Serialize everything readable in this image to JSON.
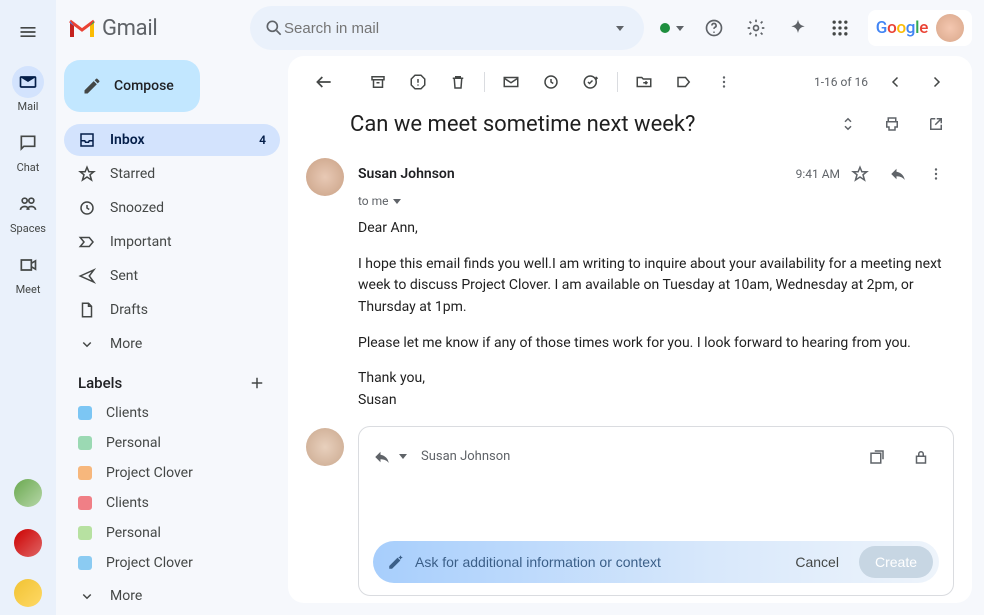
{
  "brand": {
    "name": "Gmail"
  },
  "search": {
    "placeholder": "Search in mail"
  },
  "rail": {
    "items": [
      {
        "label": "Mail"
      },
      {
        "label": "Chat"
      },
      {
        "label": "Spaces"
      },
      {
        "label": "Meet"
      }
    ]
  },
  "compose": {
    "label": "Compose"
  },
  "nav": {
    "inbox": {
      "label": "Inbox",
      "count": "4"
    },
    "starred": {
      "label": "Starred"
    },
    "snoozed": {
      "label": "Snoozed"
    },
    "important": {
      "label": "Important"
    },
    "sent": {
      "label": "Sent"
    },
    "drafts": {
      "label": "Drafts"
    },
    "more": {
      "label": "More"
    }
  },
  "labels": {
    "header": "Labels",
    "items": [
      {
        "name": "Clients",
        "color": "#7cc6f4"
      },
      {
        "name": "Personal",
        "color": "#9bd9b3"
      },
      {
        "name": "Project Clover",
        "color": "#f7b77c"
      },
      {
        "name": "Clients",
        "color": "#f07f86"
      },
      {
        "name": "Personal",
        "color": "#b7e1a1"
      },
      {
        "name": "Project Clover",
        "color": "#8bcbf2"
      }
    ],
    "more": "More"
  },
  "toolbar": {
    "page_info": "1-16 of 16"
  },
  "thread": {
    "subject": "Can we meet sometime next week?",
    "sender": "Susan Johnson",
    "to_line": "to me",
    "time": "9:41 AM",
    "body": {
      "greeting": "Dear Ann,",
      "p1": "I hope this email finds you well.I am writing to inquire about your availability for a meeting next week to discuss Project Clover. I am available on Tuesday at 10am, Wednesday at 2pm, or Thursday at 1pm.",
      "p2": "Please let me know if any of those times work for you. I look forward to hearing from you.",
      "signoff": "Thank you,",
      "signature": "Susan"
    }
  },
  "reply": {
    "recipient": "Susan Johnson",
    "ai_placeholder": "Ask for additional information or context",
    "cancel": "Cancel",
    "create": "Create"
  },
  "google_chip": {
    "word": "Google"
  }
}
